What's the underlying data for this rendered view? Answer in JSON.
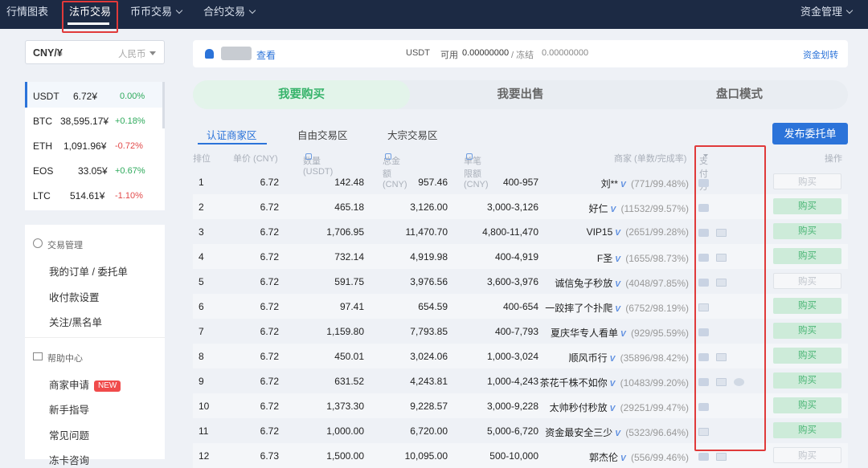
{
  "topbar": {
    "nav": [
      "行情图表",
      "法币交易",
      "币币交易",
      "合约交易"
    ],
    "right": "资金管理"
  },
  "currency": {
    "selected": "CNY/¥",
    "label": "人民币"
  },
  "rates": [
    {
      "sym": "USDT",
      "price": "6.72¥",
      "chg": "0.00%",
      "color": "#2eaa5c"
    },
    {
      "sym": "BTC",
      "price": "38,595.17¥",
      "chg": "+0.18%",
      "color": "#2eaa5c"
    },
    {
      "sym": "ETH",
      "price": "1,091.96¥",
      "chg": "-0.72%",
      "color": "#e24a4a"
    },
    {
      "sym": "EOS",
      "price": "33.05¥",
      "chg": "+0.67%",
      "color": "#2eaa5c"
    },
    {
      "sym": "LTC",
      "price": "514.61¥",
      "chg": "-1.10%",
      "color": "#e24a4a"
    }
  ],
  "menu": {
    "trade_head": "交易管理",
    "trade_items": [
      "我的订单 / 委托单",
      "收付款设置",
      "关注/黑名单"
    ],
    "help_head": "帮助中心",
    "help_items": [
      "商家申请",
      "新手指导",
      "常见问题",
      "冻卡咨询"
    ],
    "new_badge": "NEW"
  },
  "userbar": {
    "view": "查看",
    "asset": "USDT",
    "avail_label": "可用",
    "avail": "0.00000000",
    "frozen_label": "/ 冻结",
    "frozen": "0.00000000",
    "transfer": "资金划转"
  },
  "modes": [
    "我要购买",
    "我要出售",
    "盘口模式"
  ],
  "subtabs": [
    "认证商家区",
    "自由交易区",
    "大宗交易区"
  ],
  "publish": "发布委托单",
  "headers": [
    "排位",
    "单价 (CNY)",
    "数量 (USDT)",
    "总金额 (CNY)",
    "单笔限额 (CNY)",
    "商家 (单数/完成率)",
    "支付方式",
    "操作"
  ],
  "rows": [
    {
      "rank": "1",
      "price": "6.72",
      "qty": "142.48",
      "total": "957.46",
      "limit": "400-957",
      "merchant": "刘**",
      "stat": "(771/99.48%)",
      "pay": [
        "bank"
      ],
      "btn": "购买",
      "enabled": false
    },
    {
      "rank": "2",
      "price": "6.72",
      "qty": "465.18",
      "total": "3,126.00",
      "limit": "3,000-3,126",
      "merchant": "好仁",
      "stat": "(11532/99.57%)",
      "pay": [
        "bank"
      ],
      "btn": "购买",
      "enabled": true
    },
    {
      "rank": "3",
      "price": "6.72",
      "qty": "1,706.95",
      "total": "11,470.70",
      "limit": "4,800-11,470",
      "merchant": "VIP15",
      "stat": "(2651/99.28%)",
      "pay": [
        "bank",
        "ali"
      ],
      "btn": "购买",
      "enabled": true
    },
    {
      "rank": "4",
      "price": "6.72",
      "qty": "732.14",
      "total": "4,919.98",
      "limit": "400-4,919",
      "merchant": "F圣",
      "stat": "(1655/98.73%)",
      "pay": [
        "bank",
        "ali"
      ],
      "btn": "购买",
      "enabled": true
    },
    {
      "rank": "5",
      "price": "6.72",
      "qty": "591.75",
      "total": "3,976.56",
      "limit": "3,600-3,976",
      "merchant": "诚信兔子秒放",
      "stat": "(4048/97.85%)",
      "pay": [
        "bank",
        "ali"
      ],
      "btn": "购买",
      "enabled": false
    },
    {
      "rank": "6",
      "price": "6.72",
      "qty": "97.41",
      "total": "654.59",
      "limit": "400-654",
      "merchant": "一跤摔了个扑爬",
      "stat": "(6752/98.19%)",
      "pay": [
        "ali"
      ],
      "btn": "购买",
      "enabled": true
    },
    {
      "rank": "7",
      "price": "6.72",
      "qty": "1,159.80",
      "total": "7,793.85",
      "limit": "400-7,793",
      "merchant": "夏庆华专人看单",
      "stat": "(929/95.59%)",
      "pay": [
        "bank"
      ],
      "btn": "购买",
      "enabled": true
    },
    {
      "rank": "8",
      "price": "6.72",
      "qty": "450.01",
      "total": "3,024.06",
      "limit": "1,000-3,024",
      "merchant": "顺风币行",
      "stat": "(35896/98.42%)",
      "pay": [
        "bank",
        "ali"
      ],
      "btn": "购买",
      "enabled": true
    },
    {
      "rank": "9",
      "price": "6.72",
      "qty": "631.52",
      "total": "4,243.81",
      "limit": "1,000-4,243",
      "merchant": "茶花千株不如你",
      "stat": "(10483/99.20%)",
      "pay": [
        "bank",
        "ali",
        "wx"
      ],
      "btn": "购买",
      "enabled": true
    },
    {
      "rank": "10",
      "price": "6.72",
      "qty": "1,373.30",
      "total": "9,228.57",
      "limit": "3,000-9,228",
      "merchant": "太帅秒付秒放",
      "stat": "(29251/99.47%)",
      "pay": [
        "bank"
      ],
      "btn": "购买",
      "enabled": true
    },
    {
      "rank": "11",
      "price": "6.72",
      "qty": "1,000.00",
      "total": "6,720.00",
      "limit": "5,000-6,720",
      "merchant": "资金最安全三少",
      "stat": "(5323/96.64%)",
      "pay": [
        "ali"
      ],
      "btn": "购买",
      "enabled": true
    },
    {
      "rank": "12",
      "price": "6.73",
      "qty": "1,500.00",
      "total": "10,095.00",
      "limit": "500-10,000",
      "merchant": "郭杰伦",
      "stat": "(556/99.46%)",
      "pay": [
        "bank",
        "ali"
      ],
      "btn": "购买",
      "enabled": false
    }
  ]
}
